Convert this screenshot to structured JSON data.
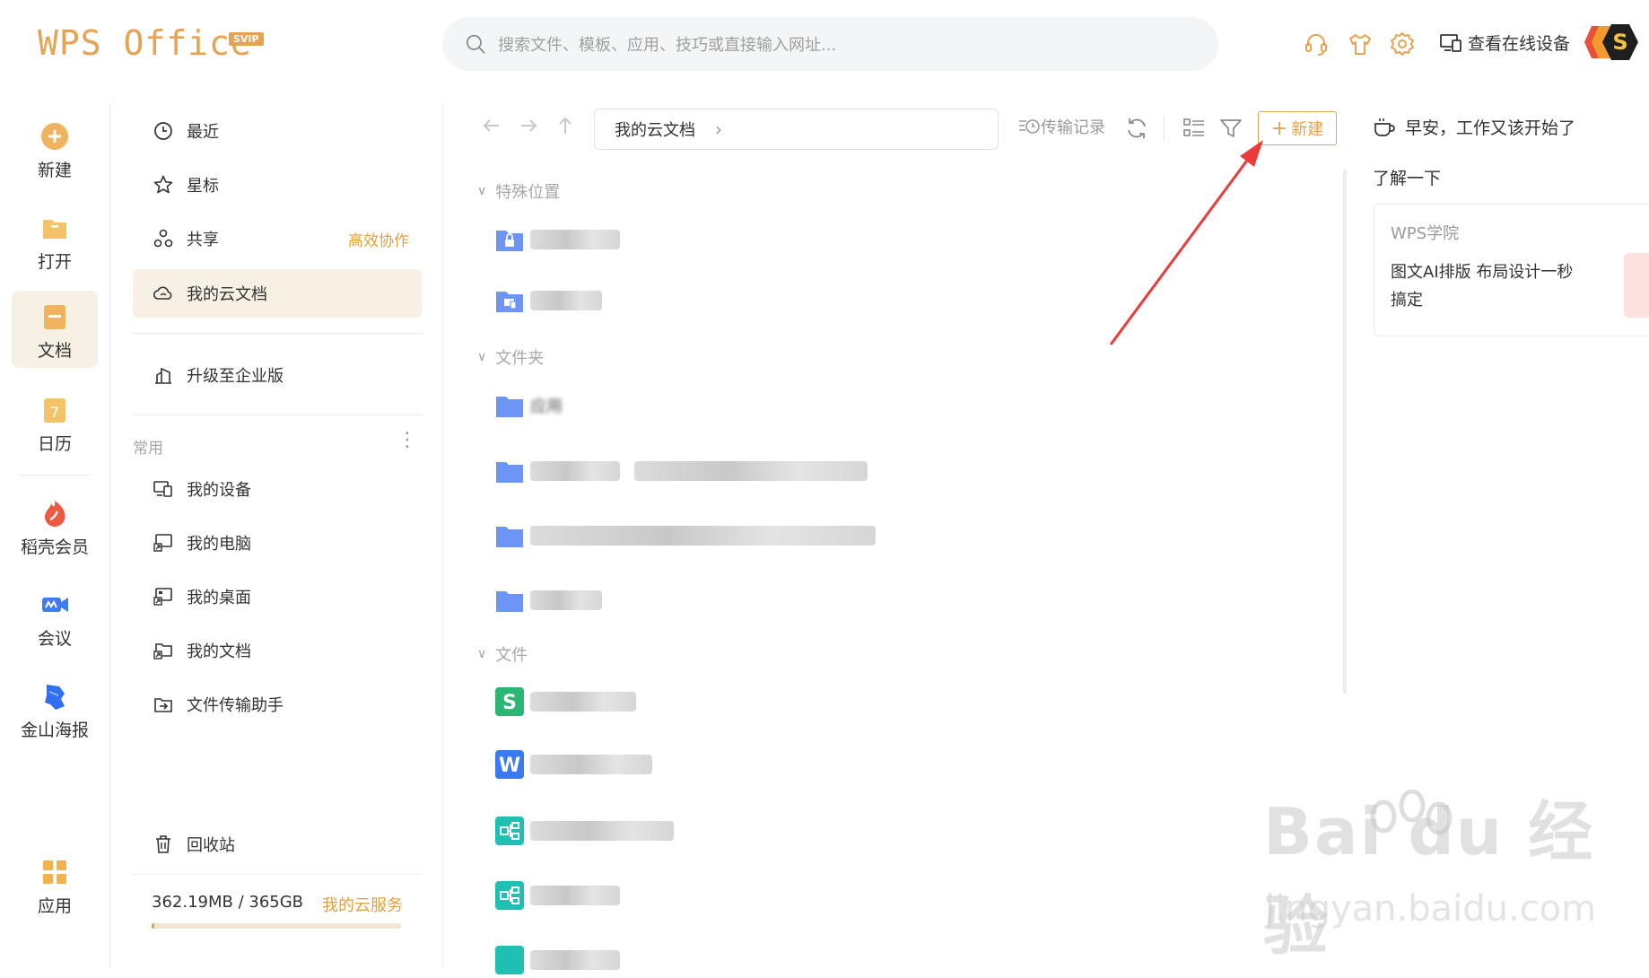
{
  "app": {
    "logo_text": "WPS Office",
    "badge": "SVIP",
    "accent": "#e6a352"
  },
  "search": {
    "placeholder": "搜索文件、模板、应用、技巧或直接输入网址..."
  },
  "topbar": {
    "online_devices_label": "查看在线设备"
  },
  "rail": {
    "items": [
      {
        "label": "新建",
        "icon": "plus-circle-icon"
      },
      {
        "label": "打开",
        "icon": "folder-open-icon"
      },
      {
        "label": "文档",
        "icon": "document-icon",
        "active": true
      },
      {
        "label": "日历",
        "icon": "calendar-icon"
      },
      {
        "label": "稻壳会员",
        "icon": "docer-member-icon"
      },
      {
        "label": "会议",
        "icon": "meeting-icon"
      },
      {
        "label": "金山海报",
        "icon": "poster-icon"
      },
      {
        "label": "应用",
        "icon": "apps-grid-icon"
      }
    ]
  },
  "nav": {
    "items": [
      {
        "label": "最近",
        "icon": "clock-icon"
      },
      {
        "label": "星标",
        "icon": "star-icon"
      },
      {
        "label": "共享",
        "icon": "share-icon",
        "tag": "高效协作"
      },
      {
        "label": "我的云文档",
        "icon": "cloud-icon",
        "active": true
      }
    ],
    "upgrade_label": "升级至企业版",
    "common_label": "常用",
    "common_items": [
      {
        "label": "我的设备",
        "icon": "device-icon"
      },
      {
        "label": "我的电脑",
        "icon": "computer-icon"
      },
      {
        "label": "我的桌面",
        "icon": "desktop-icon"
      },
      {
        "label": "我的文档",
        "icon": "my-docs-icon"
      },
      {
        "label": "文件传输助手",
        "icon": "transfer-assistant-icon"
      }
    ],
    "recycle_label": "回收站",
    "storage_text": "362.19MB / 365GB",
    "storage_used_fraction": 0.001,
    "cloud_service_label": "我的云服务"
  },
  "main": {
    "breadcrumb": "我的云文档",
    "transfer_label": "传输记录",
    "new_label": "新建",
    "sections": {
      "special": "特殊位置",
      "folders": "文件夹",
      "files": "文件"
    },
    "folder_partial_name": "应用"
  },
  "right": {
    "greeting": "早安，工作又该开始了",
    "learn_more": "了解一下",
    "card_title": "WPS学院",
    "card_text": "图文AI排版 布局设计一秒搞定"
  },
  "watermark": {
    "brand": "Bai du 经验",
    "url": "jingyan.baidu.com"
  }
}
